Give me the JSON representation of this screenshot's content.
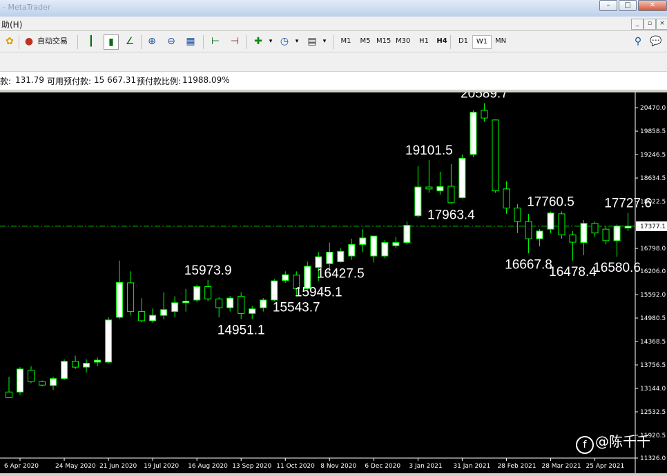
{
  "window": {
    "title": "- MetaTrader",
    "controls": {
      "min": "–",
      "max": "□",
      "close": "✕"
    }
  },
  "menubar": {
    "help_label": "助(H)",
    "mdi_controls": {
      "min": "_",
      "restore": "▫",
      "close": "×"
    }
  },
  "toolbar": {
    "auto_trade_label": "自动交易",
    "timeframes": [
      "M1",
      "M5",
      "M15",
      "M30",
      "H1",
      "H4",
      "D1",
      "W1",
      "MN"
    ],
    "active_timeframe": "W1"
  },
  "infobar": {
    "balance_label": "款:",
    "balance_value": "131.79",
    "free_margin_label": "可用预付款:",
    "free_margin_value": "15 667.31",
    "margin_level_label": "预付款比例:",
    "margin_level_value": "11988.09%"
  },
  "watermark": {
    "text": "@陈千千",
    "logo": "f"
  },
  "colors": {
    "background": "#000000",
    "bull_body": "#ffffff",
    "bear_body": "#000000",
    "wick": "#00ff00",
    "current_price_line": "#00c800",
    "text": "#ffffff"
  },
  "chart_data": {
    "type": "candlestick",
    "timeframe": "W1",
    "ylim": [
      11326.0,
      20868.0
    ],
    "y_ticks": [
      20470.0,
      19858.5,
      19246.5,
      18634.5,
      18022.5,
      17377.1,
      16798.0,
      16206.0,
      15592.0,
      14980.5,
      14368.5,
      13756.5,
      13144.0,
      12532.5,
      11920.5,
      11326.0
    ],
    "current_price": 17377.1,
    "x_tick_labels": [
      "6 Apr 2020",
      "24 May 2020",
      "21 Jun 2020",
      "19 Jul 2020",
      "16 Aug 2020",
      "13 Sep 2020",
      "11 Oct 2020",
      "8 Nov 2020",
      "6 Dec 2020",
      "3 Jan 2021",
      "31 Jan 2021",
      "28 Feb 2021",
      "28 Mar 2021",
      "25 Apr 2021"
    ],
    "annotations": [
      {
        "text": "20589.7",
        "kind": "high"
      },
      {
        "text": "19101.5",
        "kind": "high"
      },
      {
        "text": "17963.4",
        "kind": "low"
      },
      {
        "text": "17760.5",
        "kind": "high"
      },
      {
        "text": "17727.6",
        "kind": "high"
      },
      {
        "text": "16667.8",
        "kind": "low"
      },
      {
        "text": "16478.4",
        "kind": "low"
      },
      {
        "text": "16580.6",
        "kind": "low"
      },
      {
        "text": "16427.5",
        "kind": "low"
      },
      {
        "text": "15973.9",
        "kind": "high"
      },
      {
        "text": "15945.1",
        "kind": "low"
      },
      {
        "text": "15543.7",
        "kind": "low"
      },
      {
        "text": "14951.1",
        "kind": "low"
      }
    ],
    "candles": [
      {
        "o": 13050,
        "h": 13450,
        "l": 12950,
        "c": 12900
      },
      {
        "o": 13050,
        "h": 13700,
        "l": 12980,
        "c": 13650
      },
      {
        "o": 13620,
        "h": 13720,
        "l": 13280,
        "c": 13320
      },
      {
        "o": 13320,
        "h": 13350,
        "l": 13200,
        "c": 13230
      },
      {
        "o": 13220,
        "h": 13450,
        "l": 13100,
        "c": 13400
      },
      {
        "o": 13400,
        "h": 13900,
        "l": 13360,
        "c": 13850
      },
      {
        "o": 13850,
        "h": 14000,
        "l": 13650,
        "c": 13700
      },
      {
        "o": 13700,
        "h": 13900,
        "l": 13560,
        "c": 13800
      },
      {
        "o": 13830,
        "h": 13950,
        "l": 13720,
        "c": 13880
      },
      {
        "o": 13830,
        "h": 15000,
        "l": 13800,
        "c": 14930
      },
      {
        "o": 15000,
        "h": 16480,
        "l": 14950,
        "c": 15910
      },
      {
        "o": 15900,
        "h": 16200,
        "l": 15050,
        "c": 15150
      },
      {
        "o": 15150,
        "h": 15500,
        "l": 14870,
        "c": 14910
      },
      {
        "o": 14910,
        "h": 15230,
        "l": 14860,
        "c": 15050
      },
      {
        "o": 15050,
        "h": 15650,
        "l": 14950,
        "c": 15200
      },
      {
        "o": 15150,
        "h": 15550,
        "l": 15000,
        "c": 15380
      },
      {
        "o": 15380,
        "h": 15740,
        "l": 15150,
        "c": 15420
      },
      {
        "o": 15450,
        "h": 15850,
        "l": 15400,
        "c": 15800
      },
      {
        "o": 15800,
        "h": 15974,
        "l": 15420,
        "c": 15480
      },
      {
        "o": 15480,
        "h": 15520,
        "l": 15000,
        "c": 15250
      },
      {
        "o": 15250,
        "h": 15560,
        "l": 15150,
        "c": 15500
      },
      {
        "o": 15550,
        "h": 15650,
        "l": 14951,
        "c": 15100
      },
      {
        "o": 15100,
        "h": 15300,
        "l": 14951,
        "c": 15220
      },
      {
        "o": 15250,
        "h": 15500,
        "l": 15150,
        "c": 15450
      },
      {
        "o": 15450,
        "h": 16000,
        "l": 15420,
        "c": 15950
      },
      {
        "o": 15960,
        "h": 16200,
        "l": 15900,
        "c": 16110
      },
      {
        "o": 16100,
        "h": 16200,
        "l": 15544,
        "c": 15750
      },
      {
        "o": 15750,
        "h": 16450,
        "l": 15700,
        "c": 16330
      },
      {
        "o": 16300,
        "h": 16700,
        "l": 15945,
        "c": 16580
      },
      {
        "o": 16400,
        "h": 16950,
        "l": 16200,
        "c": 16700
      },
      {
        "o": 16450,
        "h": 16800,
        "l": 16430,
        "c": 16720
      },
      {
        "o": 16600,
        "h": 17050,
        "l": 16500,
        "c": 16900
      },
      {
        "o": 16900,
        "h": 17300,
        "l": 16700,
        "c": 17070
      },
      {
        "o": 16600,
        "h": 17100,
        "l": 16430,
        "c": 17120
      },
      {
        "o": 16600,
        "h": 17020,
        "l": 16540,
        "c": 16950
      },
      {
        "o": 16870,
        "h": 17100,
        "l": 16800,
        "c": 16950
      },
      {
        "o": 16950,
        "h": 17500,
        "l": 16900,
        "c": 17400
      },
      {
        "o": 17650,
        "h": 18950,
        "l": 17600,
        "c": 18400
      },
      {
        "o": 18400,
        "h": 19102,
        "l": 18250,
        "c": 18350
      },
      {
        "o": 18300,
        "h": 18800,
        "l": 18200,
        "c": 18410
      },
      {
        "o": 18420,
        "h": 19000,
        "l": 17963,
        "c": 17990
      },
      {
        "o": 18120,
        "h": 19250,
        "l": 18100,
        "c": 19150
      },
      {
        "o": 19250,
        "h": 20400,
        "l": 19180,
        "c": 20350
      },
      {
        "o": 20400,
        "h": 20590,
        "l": 20100,
        "c": 20200
      },
      {
        "o": 20150,
        "h": 20160,
        "l": 18250,
        "c": 18300
      },
      {
        "o": 18350,
        "h": 18550,
        "l": 17700,
        "c": 17850
      },
      {
        "o": 17850,
        "h": 17950,
        "l": 17200,
        "c": 17500
      },
      {
        "o": 17500,
        "h": 17700,
        "l": 16668,
        "c": 17050
      },
      {
        "o": 17050,
        "h": 17300,
        "l": 16850,
        "c": 17250
      },
      {
        "o": 17300,
        "h": 17760,
        "l": 17200,
        "c": 17720
      },
      {
        "o": 17700,
        "h": 17761,
        "l": 17050,
        "c": 17150
      },
      {
        "o": 17150,
        "h": 17250,
        "l": 16478,
        "c": 16960
      },
      {
        "o": 16950,
        "h": 17540,
        "l": 16620,
        "c": 17450
      },
      {
        "o": 17450,
        "h": 17500,
        "l": 17100,
        "c": 17200
      },
      {
        "o": 17300,
        "h": 17380,
        "l": 16900,
        "c": 17000
      },
      {
        "o": 17000,
        "h": 17420,
        "l": 16581,
        "c": 17380
      },
      {
        "o": 17330,
        "h": 17728,
        "l": 17250,
        "c": 17377
      }
    ]
  }
}
